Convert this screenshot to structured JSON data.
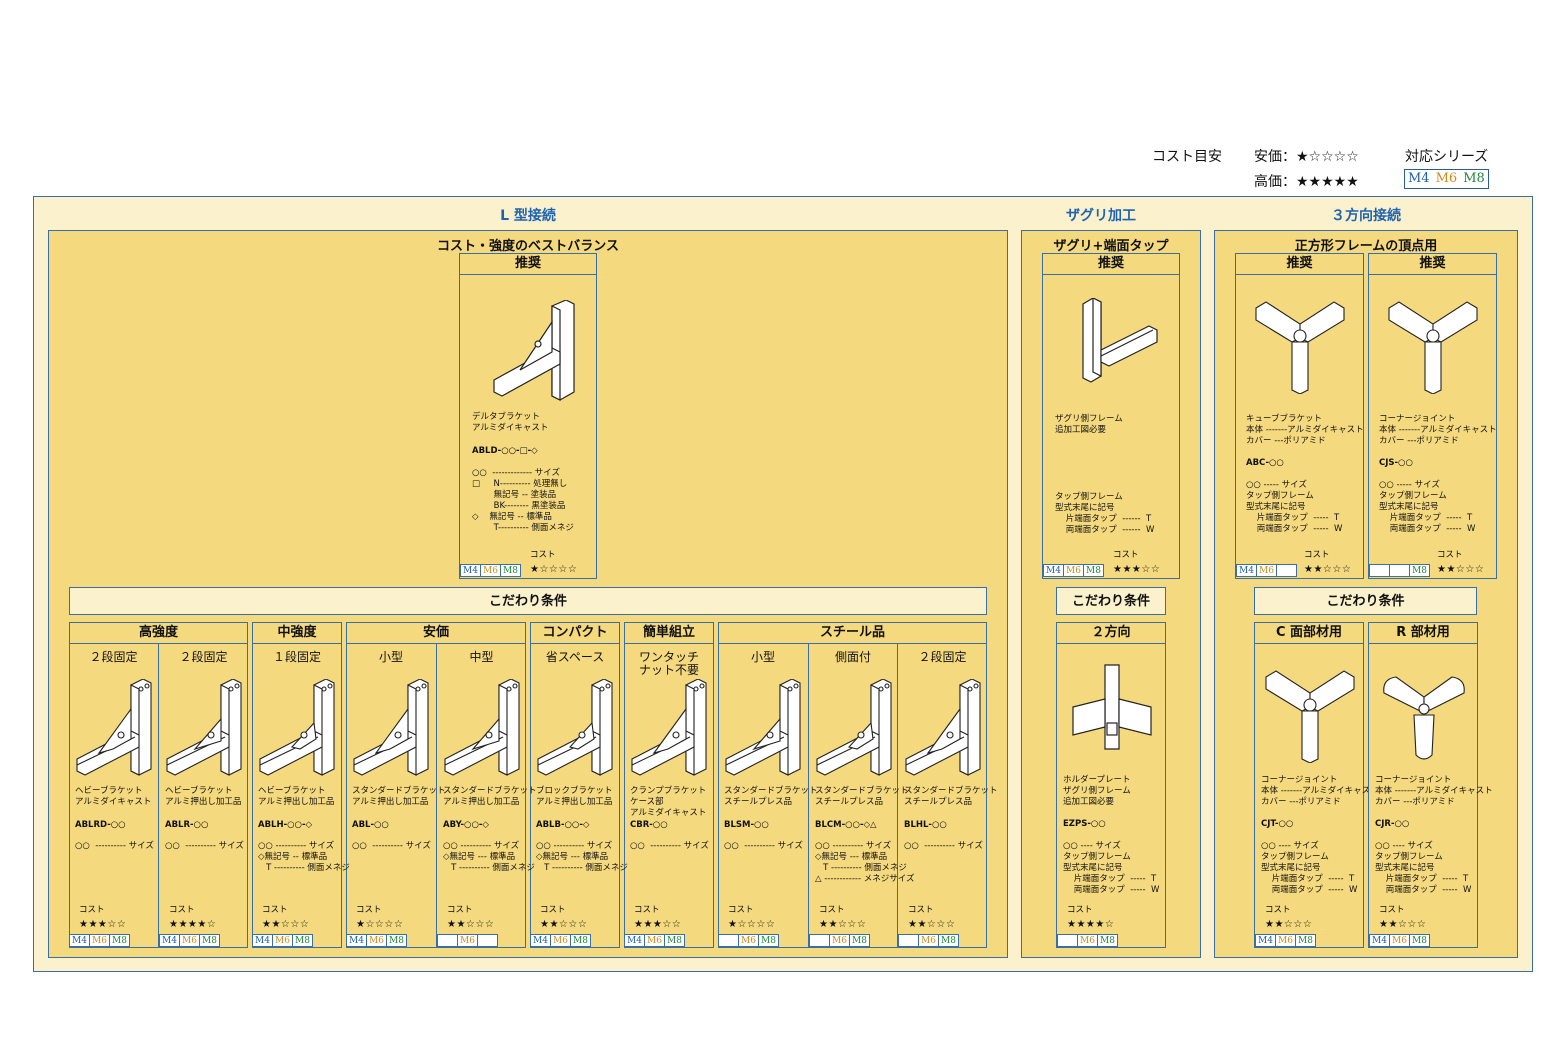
{
  "legend": {
    "cost_label": "コスト目安",
    "cheap": "安価：★☆☆☆☆",
    "expensive": "高価：★★★★★",
    "series_label": "対応シリーズ",
    "series": [
      "M4",
      "M6",
      "M8"
    ]
  },
  "sections": {
    "l_joint": "L 型接続",
    "counterbore": "ザグリ加工",
    "three_way": "３方向接続"
  },
  "l_panel": {
    "title": "コスト・強度のベストバランス",
    "recommend": "推奨",
    "featured": {
      "desc": "デルタブラケット\nアルミダイキャスト",
      "code": "ABLD-○○-□-◇",
      "spec": "○○  ------------- サイズ\n□     N---------- 処理無し\n        無記号 -- 塗装品\n        BK-------- 黒塗装品\n◇    無記号 -- 標準品\n        T---------- 側面メネジ",
      "cost_label": "コスト",
      "stars": "★☆☆☆☆",
      "series": [
        "M4",
        "M6",
        "M8"
      ]
    },
    "conditions": "こだわり条件",
    "groups": [
      "高強度",
      "中強度",
      "安価",
      "コンパクト",
      "簡単組立",
      "スチール品"
    ],
    "cards": [
      {
        "sub": "２段固定",
        "desc": "ヘビーブラケット\nアルミダイキャスト",
        "code": "ABLRD-○○",
        "spec": "○○  ---------- サイズ",
        "stars": "★★★☆☆",
        "series": [
          "M4",
          "M6",
          "M8"
        ]
      },
      {
        "sub": "２段固定",
        "desc": "ヘビーブラケット\nアルミ押出し加工品",
        "code": "ABLR-○○",
        "spec": "○○  ---------- サイズ",
        "stars": "★★★★☆",
        "series": [
          "M4",
          "M6",
          "M8"
        ]
      },
      {
        "sub": "１段固定",
        "desc": "ヘビーブラケット\nアルミ押出し加工品",
        "code": "ABLH-○○-◇",
        "spec": "○○ ---------- サイズ\n◇無記号 -- 標準品\n   T ---------- 側面メネジ",
        "stars": "★★☆☆☆",
        "series": [
          "M4",
          "M6",
          "M8"
        ]
      },
      {
        "sub": "小型",
        "desc": "スタンダードブラケット\nアルミ押出し加工品",
        "code": "ABL-○○",
        "spec": "○○  ---------- サイズ",
        "stars": "★☆☆☆☆",
        "series": [
          "M4",
          "M6",
          "M8"
        ]
      },
      {
        "sub": "中型",
        "desc": "スタンダードブラケット\nアルミ押出し加工品",
        "code": "ABY-○○-◇",
        "spec": "○○ ---------- サイズ\n◇無記号 --- 標準品\n   T ---------- 側面メネジ",
        "stars": "★★☆☆☆",
        "series": [
          "",
          "M6",
          ""
        ]
      },
      {
        "sub": "省スペース",
        "desc": "ブロックブラケット\nアルミ押出し加工品",
        "code": "ABLB-○○-◇",
        "spec": "○○ ---------- サイズ\n◇無記号 --- 標準品\n   T ---------- 側面メネジ",
        "stars": "★★☆☆☆",
        "series": [
          "M4",
          "M6",
          "M8"
        ]
      },
      {
        "sub": "ワンタッチ\nナット不要",
        "desc": "クランプブラケット\nケース部\nアルミダイキャスト",
        "code": "CBR-○○",
        "spec": "○○  ---------- サイズ",
        "stars": "★★★☆☆",
        "series": [
          "M4",
          "M6",
          "M8"
        ]
      },
      {
        "sub": "小型",
        "desc": "スタンダードブラケット\nスチールプレス品",
        "code": "BLSM-○○",
        "spec": "○○  ---------- サイズ",
        "stars": "★☆☆☆☆",
        "series": [
          "",
          "M6",
          "M8"
        ]
      },
      {
        "sub": "側面付",
        "desc": "スタンダードブラケット\nスチールプレス品",
        "code": "BLCM-○○-◇△",
        "spec": "○○ ---------- サイズ\n◇無記号 --- 標準品\n   T ---------- 側面メネジ\n△ ------------ メネジサイズ",
        "stars": "★★☆☆☆",
        "series": [
          "",
          "M6",
          "M8"
        ]
      },
      {
        "sub": "２段固定",
        "desc": "スタンダードブラケット\nスチールプレス品",
        "code": "BLHL-○○",
        "spec": "○○  ---------- サイズ",
        "stars": "★★☆☆☆",
        "series": [
          "",
          "M6",
          "M8"
        ]
      }
    ]
  },
  "z_panel": {
    "title": "ザグリ+端面タップ",
    "recommend": "推奨",
    "featured": {
      "desc": "ザグリ側フレーム\n追加工図必要",
      "spec": "タップ側フレーム\n型式末尾に記号\n    片端面タップ  ------  T\n    両端面タップ  ------  W",
      "cost_label": "コスト",
      "stars": "★★★☆☆",
      "series": [
        "M4",
        "M6",
        "M8"
      ]
    },
    "conditions": "こだわり条件",
    "group": "２方向",
    "card": {
      "desc": "ホルダープレート\nザグリ側フレーム\n追加工図必要",
      "code": "EZPS-○○",
      "spec": "○○ ---- サイズ\nタップ側フレーム\n型式末尾に記号\n    片端面タップ  -----  T\n    両端面タップ  -----  W",
      "cost_label": "コスト",
      "stars": "★★★★☆",
      "series": [
        "",
        "M6",
        "M8"
      ]
    }
  },
  "t_panel": {
    "title": "正方形フレームの頂点用",
    "recommend": "推奨",
    "featured": [
      {
        "desc": "キューブブラケット\n本体 -------アルミダイキャスト\nカバー ---ポリアミド",
        "code": "ABC-○○",
        "spec": "○○ ----- サイズ\nタップ側フレーム\n型式末尾に記号\n    片端面タップ  -----  T\n    両端面タップ  -----  W",
        "cost_label": "コスト",
        "stars": "★★☆☆☆",
        "series": [
          "M4",
          "M6",
          ""
        ]
      },
      {
        "desc": "コーナージョイント\n本体 -------アルミダイキャスト\nカバー ---ポリアミド",
        "code": "CJS-○○",
        "spec": "○○ ----- サイズ\nタップ側フレーム\n型式末尾に記号\n    片端面タップ  -----  T\n    両端面タップ  -----  W",
        "cost_label": "コスト",
        "stars": "★★☆☆☆",
        "series": [
          "",
          "",
          "M8"
        ]
      }
    ],
    "conditions": "こだわり条件",
    "groups": [
      "C 面部材用",
      "R 部材用"
    ],
    "cards": [
      {
        "desc": "コーナージョイント\n本体 -------アルミダイキャスト\nカバー ---ポリアミド",
        "code": "CJT-○○",
        "spec": "○○ ---- サイズ\nタップ側フレーム\n型式末尾に記号\n    片端面タップ  -----  T\n    両端面タップ  -----  W",
        "cost_label": "コスト",
        "stars": "★★☆☆☆",
        "series": [
          "M4",
          "M6",
          "M8"
        ]
      },
      {
        "desc": "コーナージョイント\n本体 -------アルミダイキャスト\nカバー ---ポリアミド",
        "code": "CJR-○○",
        "spec": "○○ ---- サイズ\nタップ側フレーム\n型式末尾に記号\n    片端面タップ  -----  T\n    両端面タップ  -----  W",
        "cost_label": "コスト",
        "stars": "★★☆☆☆",
        "series": [
          "M4",
          "M6",
          "M8"
        ]
      }
    ]
  }
}
